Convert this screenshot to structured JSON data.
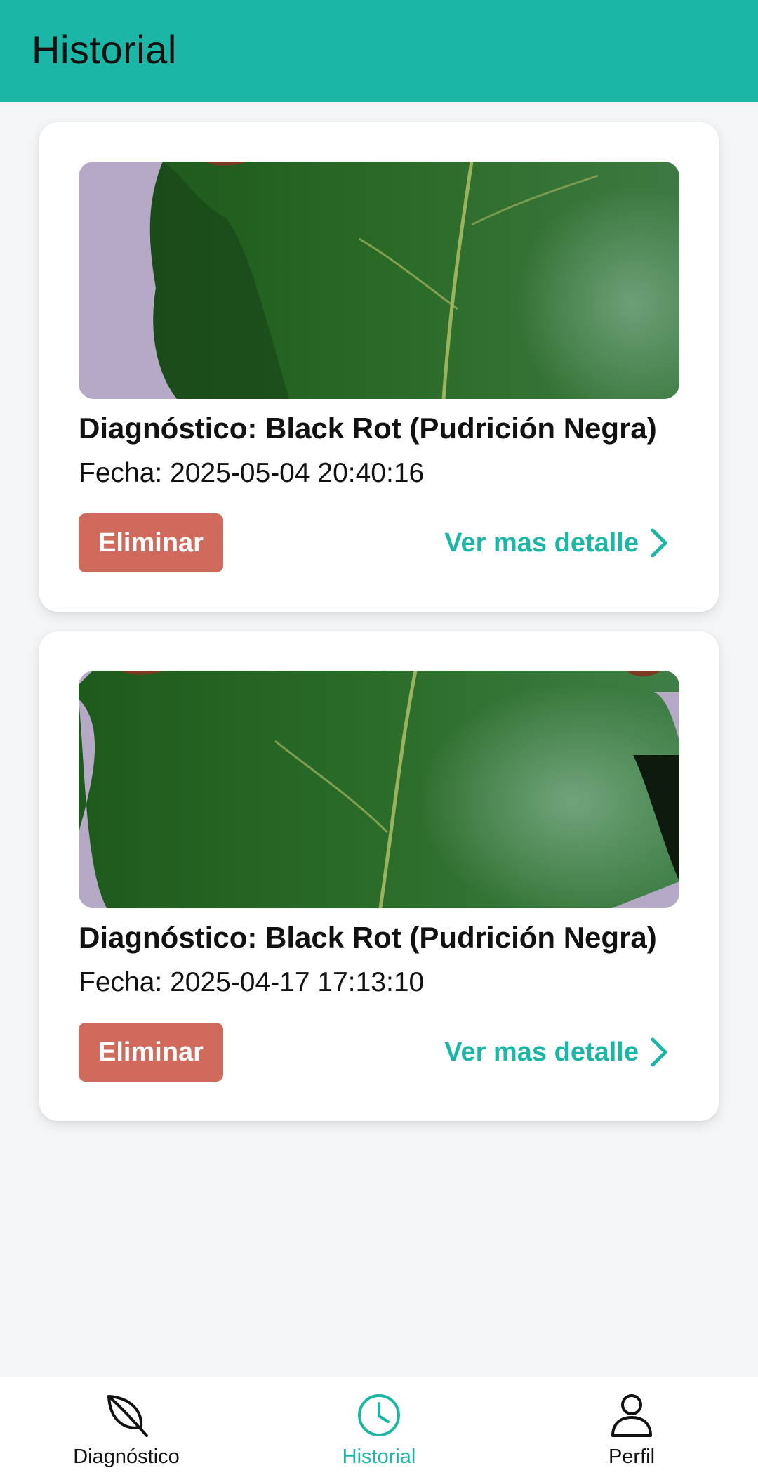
{
  "app_bar": {
    "title": "Historial"
  },
  "colors": {
    "primary": "#1bb6a6",
    "danger": "#d06a5c",
    "background": "#f5f6f8"
  },
  "history": [
    {
      "title": "Diagnóstico: Black Rot (Pudrición Negra)",
      "date": "Fecha: 2025-05-04 20:40:16",
      "delete_label": "Eliminar",
      "detail_label": "Ver mas detalle",
      "image_icon": "leaf-photo"
    },
    {
      "title": "Diagnóstico: Black Rot (Pudrición Negra)",
      "date": "Fecha: 2025-04-17 17:13:10",
      "delete_label": "Eliminar",
      "detail_label": "Ver mas detalle",
      "image_icon": "leaf-photo"
    }
  ],
  "bottom_nav": {
    "items": [
      {
        "label": "Diagnóstico",
        "icon": "leaf-icon",
        "active": false
      },
      {
        "label": "Historial",
        "icon": "clock-icon",
        "active": true
      },
      {
        "label": "Perfil",
        "icon": "person-icon",
        "active": false
      }
    ]
  }
}
